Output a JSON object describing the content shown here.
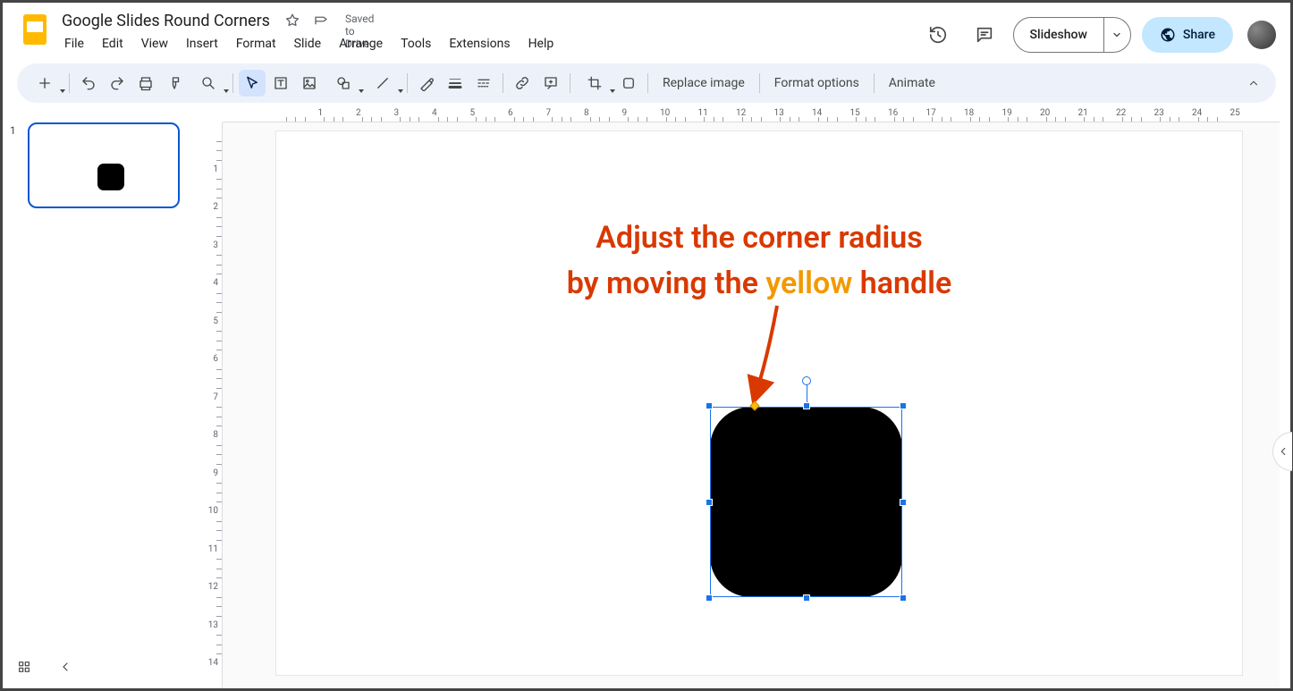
{
  "header": {
    "doc_title": "Google Slides Round Corners",
    "saved_status": "Saved to Drive",
    "menus": [
      "File",
      "Edit",
      "View",
      "Insert",
      "Format",
      "Slide",
      "Arrange",
      "Tools",
      "Extensions",
      "Help"
    ],
    "slideshow_label": "Slideshow",
    "share_label": "Share"
  },
  "toolbar": {
    "replace_image": "Replace image",
    "format_options": "Format options",
    "animate": "Animate"
  },
  "filmstrip": {
    "slides": [
      {
        "number": "1"
      }
    ]
  },
  "ruler": {
    "h_labels": [
      "1",
      "2",
      "3",
      "4",
      "5",
      "6",
      "7",
      "8",
      "9",
      "10",
      "11",
      "12",
      "13",
      "14",
      "15",
      "16",
      "17",
      "18",
      "19",
      "20",
      "21",
      "22",
      "23",
      "24",
      "25"
    ],
    "v_labels": [
      "1",
      "2",
      "3",
      "4",
      "5",
      "6",
      "7",
      "8",
      "9",
      "10",
      "11",
      "12",
      "13",
      "14"
    ]
  },
  "slide_content": {
    "annotation_line1": "Adjust the corner radius",
    "annotation_line2_pre": "by moving the ",
    "annotation_line2_highlight": "yellow",
    "annotation_line2_post": " handle"
  }
}
